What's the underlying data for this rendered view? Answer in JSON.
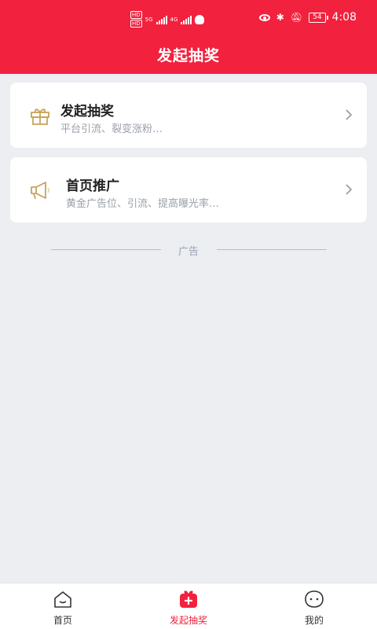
{
  "status_bar": {
    "hd1": "HD",
    "hd2": "HD",
    "net1": "5G",
    "net2": "4G",
    "battery": "54",
    "time": "4:08"
  },
  "header": {
    "title": "发起抽奖"
  },
  "cards": [
    {
      "title": "发起抽奖",
      "subtitle": "平台引流、裂变涨粉…",
      "icon": "gift-icon"
    },
    {
      "title": "首页推广",
      "subtitle": "黄金广告位、引流、提高曝光率…",
      "icon": "megaphone-icon"
    }
  ],
  "ad": {
    "label": "广告"
  },
  "tabbar": {
    "items": [
      {
        "label": "首页",
        "icon": "home-icon",
        "active": false
      },
      {
        "label": "发起抽奖",
        "icon": "gift-box-icon",
        "active": true
      },
      {
        "label": "我的",
        "icon": "chat-face-icon",
        "active": false
      }
    ],
    "accent": "#f2213e"
  },
  "colors": {
    "header_bg": "#f2213e",
    "page_bg": "#eceef2",
    "icon_gold": "#c9a35a"
  }
}
